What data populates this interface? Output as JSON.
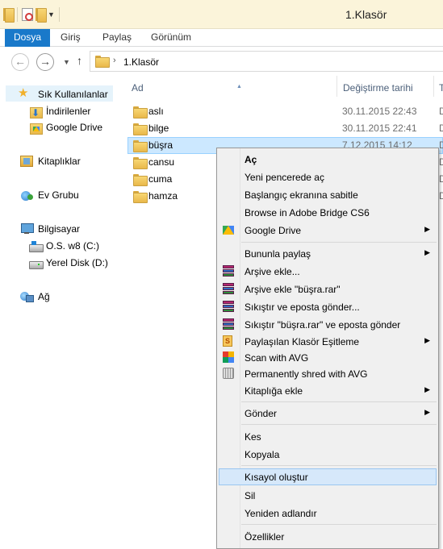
{
  "window": {
    "title": "1.Klasör"
  },
  "ribbon": {
    "tabs": [
      {
        "label": "Dosya"
      },
      {
        "label": "Giriş"
      },
      {
        "label": "Paylaş"
      },
      {
        "label": "Görünüm"
      }
    ]
  },
  "address": {
    "path": "1.Klasör"
  },
  "nav": {
    "favorites": "Sık Kullanılanlar",
    "downloads": "İndirilenler",
    "google_drive": "Google Drive",
    "libraries": "Kitaplıklar",
    "homegroup": "Ev Grubu",
    "computer": "Bilgisayar",
    "drive_c": "O.S. w8 (C:)",
    "drive_d": "Yerel Disk (D:)",
    "network": "Ağ"
  },
  "columns": {
    "name": "Ad",
    "date": "Değiştirme tarihi",
    "type": "T"
  },
  "files": [
    {
      "name": "aslı",
      "date": "30.11.2015 22:43",
      "type": "D"
    },
    {
      "name": "bilge",
      "date": "30.11.2015 22:41",
      "type": "D"
    },
    {
      "name": "büşra",
      "date": "7.12.2015 14:12",
      "type": "D"
    },
    {
      "name": "cansu",
      "date": "",
      "type": "D"
    },
    {
      "name": "cuma",
      "date": "",
      "type": "D"
    },
    {
      "name": "hamza",
      "date": "",
      "type": "D"
    }
  ],
  "context_menu": {
    "items": [
      {
        "label": "Aç"
      },
      {
        "label": "Yeni pencerede aç"
      },
      {
        "label": "Başlangıç ekranına sabitle"
      },
      {
        "label": "Browse in Adobe Bridge CS6"
      },
      {
        "label": "Google Drive"
      },
      {
        "label": "Bununla paylaş"
      },
      {
        "label": "Arşive ekle..."
      },
      {
        "label": "Arşive ekle \"büşra.rar\""
      },
      {
        "label": "Sıkıştır ve eposta gönder..."
      },
      {
        "label": "Sıkıştır \"büşra.rar\" ve eposta gönder"
      },
      {
        "label": "Paylaşılan Klasör Eşitleme"
      },
      {
        "label": "Scan with AVG"
      },
      {
        "label": "Permanently shred with AVG"
      },
      {
        "label": "Kitaplığa ekle"
      },
      {
        "label": "Gönder"
      },
      {
        "label": "Kes"
      },
      {
        "label": "Kopyala"
      },
      {
        "label": "Kısayol oluştur"
      },
      {
        "label": "Sil"
      },
      {
        "label": "Yeniden adlandır"
      },
      {
        "label": "Özellikler"
      }
    ]
  },
  "colors": {
    "accent": "#1979ca",
    "selection": "#cce8ff",
    "menu_highlight": "#d6e8fa"
  }
}
